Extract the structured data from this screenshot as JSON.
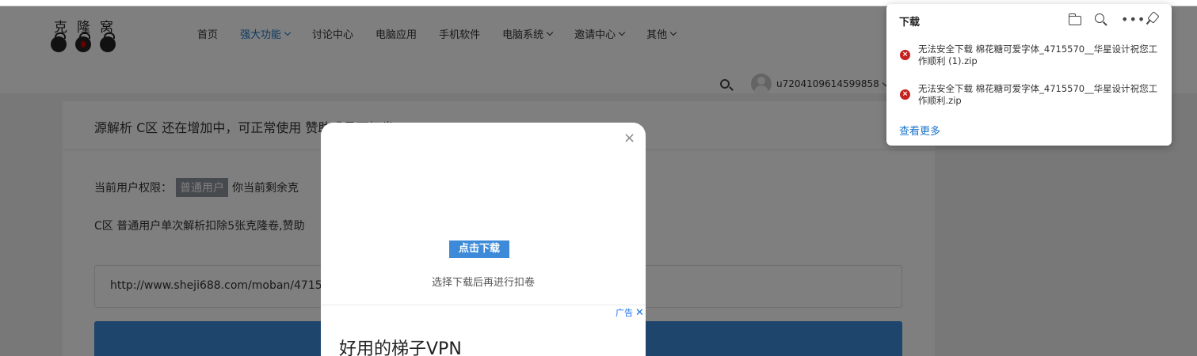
{
  "header": {
    "logo_text": "克隆窝",
    "nav": [
      {
        "label": "首页",
        "active": false,
        "has_dropdown": false
      },
      {
        "label": "强大功能",
        "active": true,
        "has_dropdown": true
      },
      {
        "label": "讨论中心",
        "active": false,
        "has_dropdown": false
      },
      {
        "label": "电脑应用",
        "active": false,
        "has_dropdown": false
      },
      {
        "label": "手机软件",
        "active": false,
        "has_dropdown": false
      },
      {
        "label": "电脑系统",
        "active": false,
        "has_dropdown": true
      },
      {
        "label": "邀请中心",
        "active": false,
        "has_dropdown": true
      },
      {
        "label": "其他",
        "active": false,
        "has_dropdown": true
      }
    ],
    "username": "u7204109614599858"
  },
  "main": {
    "notice": "源解析 C区 还在增加中，可正常使用 赞助成员不扣卷",
    "permission_label": "当前用户权限：",
    "permission_badge": "普通用户",
    "permission_rest": "你当前剩余克",
    "rule_text": "C区 普通用户单次解析扣除5张克隆卷,赞助",
    "url_value": "http://www.sheji688.com/moban/4715"
  },
  "modal": {
    "close_glyph": "×",
    "download_button": "点击下载",
    "hint": "选择下载后再进行扣卷",
    "ad_label": "广告",
    "ad_close": "✕",
    "ad_title": "好用的梯子VPN"
  },
  "download_panel": {
    "title": "下载",
    "items": [
      {
        "name": "无法安全下载 棉花糖可爱字体_4715570__华星设计祝您工作顺利 (1).zip"
      },
      {
        "name": "无法安全下载 棉花糖可爱字体_4715570__华星设计祝您工作顺利.zip"
      }
    ],
    "see_more": "查看更多"
  },
  "colors": {
    "accent": "#3d8bd8",
    "active_nav": "#1a73c9",
    "error": "#c5221f"
  }
}
